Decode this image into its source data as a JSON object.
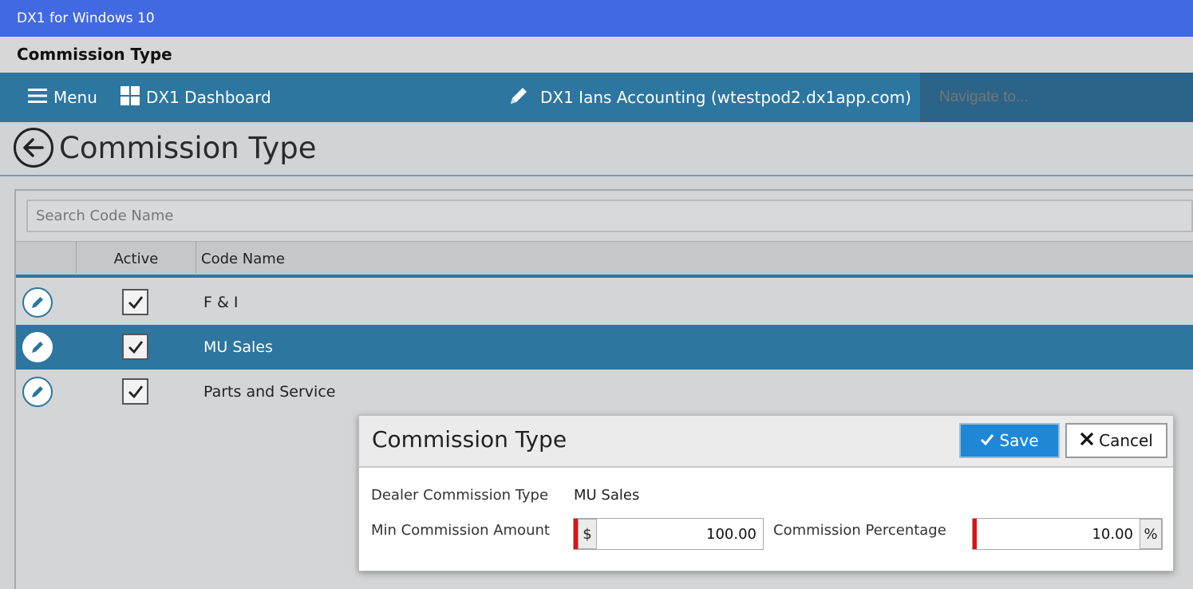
{
  "window": {
    "title": "DX1 for Windows 10"
  },
  "app_header": {
    "title": "Commission Type"
  },
  "navbar": {
    "menu_label": "Menu",
    "dashboard_label": "DX1 Dashboard",
    "account_label": "DX1 Ians Accounting (wtestpod2.dx1app.com)",
    "navigate_placeholder": "Navigate to..."
  },
  "page": {
    "title": "Commission Type"
  },
  "grid": {
    "search_placeholder": "Search Code Name",
    "columns": [
      "Active",
      "Code Name"
    ],
    "rows": [
      {
        "active": true,
        "code_name": "F & I",
        "selected": false
      },
      {
        "active": true,
        "code_name": "MU Sales",
        "selected": true
      },
      {
        "active": true,
        "code_name": "Parts and Service",
        "selected": false
      }
    ]
  },
  "dialog": {
    "title": "Commission Type",
    "save_label": "Save",
    "cancel_label": "Cancel",
    "dealer_type_label": "Dealer Commission Type",
    "dealer_type_value": "MU Sales",
    "min_amount_label": "Min Commission Amount",
    "min_amount_prefix": "$",
    "min_amount_value": "100.00",
    "percentage_label": "Commission Percentage",
    "percentage_value": "10.00",
    "percentage_suffix": "%"
  },
  "colors": {
    "titlebar": "#4169e1",
    "navbar": "#2c76a0",
    "selected_row": "#2c76a0",
    "save_button": "#1e88d7",
    "required_marker": "#e01010"
  }
}
